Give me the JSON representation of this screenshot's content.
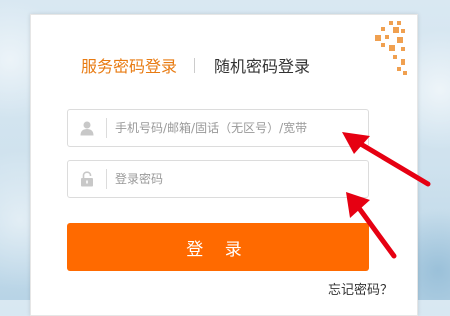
{
  "tabs": {
    "service_password": "服务密码登录",
    "random_password": "随机密码登录"
  },
  "account_field": {
    "placeholder": "手机号码/邮箱/固话（无区号）/宽带",
    "icon": "user-icon"
  },
  "password_field": {
    "placeholder": "登录密码",
    "icon": "lock-icon"
  },
  "login_button": {
    "label": "登 录"
  },
  "forgot_password": {
    "label": "忘记密码？"
  },
  "colors": {
    "accent": "#ff6a00",
    "active_tab": "#e87b12",
    "arrow": "#e60012"
  }
}
